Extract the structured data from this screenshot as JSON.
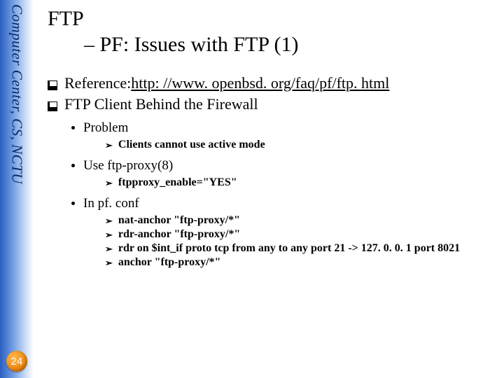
{
  "sidebar": {
    "label": "Computer Center, CS, NCTU"
  },
  "page": {
    "number": "24"
  },
  "title": {
    "line1": "FTP",
    "line2": "– PF: Issues with FTP (1)"
  },
  "bullets": {
    "reference_label": "Reference: ",
    "reference_link": "http: //www. openbsd. org/faq/pf/ftp. html",
    "client_firewall": "FTP Client Behind the Firewall"
  },
  "sub": {
    "problem": "Problem",
    "problem_detail": "Clients cannot use active mode",
    "use_proxy": "Use ftp-proxy(8)",
    "use_proxy_detail": "ftpproxy_enable=\"YES\"",
    "in_pfconf": "In pf. conf",
    "pfconf": {
      "a": "nat-anchor \"ftp-proxy/*\"",
      "b": "rdr-anchor \"ftp-proxy/*\"",
      "c": "rdr on $int_if proto tcp from any to any port 21 -> 127. 0. 0. 1 port 8021",
      "d": "anchor \"ftp-proxy/*\""
    }
  },
  "glyphs": {
    "tri": "➢"
  }
}
